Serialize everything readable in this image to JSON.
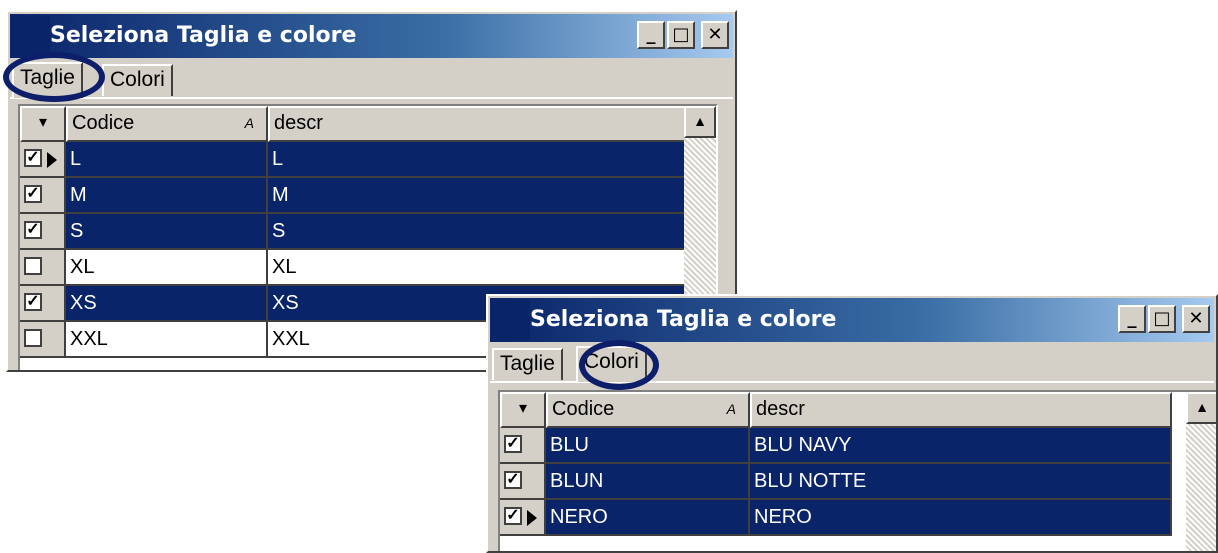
{
  "window1": {
    "title": "Seleziona Taglia e colore",
    "controls": {
      "minimize": "_",
      "maximize": "□",
      "close": "✕"
    },
    "tabs": [
      {
        "label": "Taglie",
        "active": true
      },
      {
        "label": "Colori",
        "active": false
      }
    ],
    "columns": [
      "Codice",
      "descr"
    ],
    "rows": [
      {
        "codice": "L",
        "descr": "L",
        "checked": true,
        "current": true
      },
      {
        "codice": "M",
        "descr": "M",
        "checked": true,
        "current": false
      },
      {
        "codice": "S",
        "descr": "S",
        "checked": true,
        "current": false
      },
      {
        "codice": "XL",
        "descr": "XL",
        "checked": false,
        "current": false
      },
      {
        "codice": "XS",
        "descr": "XS",
        "checked": true,
        "current": false
      },
      {
        "codice": "XXL",
        "descr": "XXL",
        "checked": false,
        "current": false
      }
    ]
  },
  "window2": {
    "title": "Seleziona Taglia e colore",
    "controls": {
      "minimize": "_",
      "maximize": "□",
      "close": "✕"
    },
    "tabs": [
      {
        "label": "Taglie",
        "active": false
      },
      {
        "label": "Colori",
        "active": true
      }
    ],
    "columns": [
      "Codice",
      "descr"
    ],
    "rows": [
      {
        "codice": "BLU",
        "descr": "BLU NAVY",
        "checked": true,
        "current": false
      },
      {
        "codice": "BLUN",
        "descr": "BLU NOTTE",
        "checked": true,
        "current": false
      },
      {
        "codice": "NERO",
        "descr": "NERO",
        "checked": true,
        "current": true
      }
    ]
  },
  "glyphs": {
    "filter": "▾",
    "sort": "A",
    "check": "✓",
    "scroll_up": "▲"
  },
  "colors": {
    "selection": "#0a246a",
    "highlight_circle": "#0d1f6a"
  }
}
